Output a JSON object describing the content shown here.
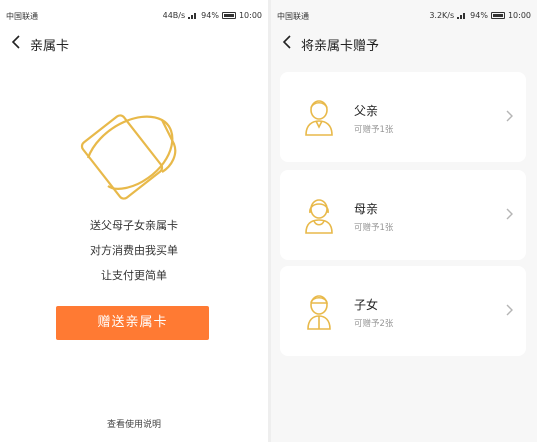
{
  "left": {
    "status": {
      "carrier": "中国联通",
      "speed": "44B/s",
      "battery": "94%",
      "time": "10:00"
    },
    "nav": {
      "title": "亲属卡"
    },
    "illustration": {
      "icon": "family-card-icon"
    },
    "copy": [
      "送父母子女亲属卡",
      "对方消费由我买单",
      "让支付更简单"
    ],
    "cta_label": "赠送亲属卡",
    "help_link": "查看使用说明",
    "accent": "#ff7a33",
    "illustration_color": "#e8b94a"
  },
  "right": {
    "status": {
      "carrier": "中国联通",
      "speed": "3.2K/s",
      "battery": "94%",
      "time": "10:00"
    },
    "nav": {
      "title": "将亲属卡赠予"
    },
    "options": [
      {
        "name": "父亲",
        "sub": "可赠予1张",
        "icon": "father-avatar-icon"
      },
      {
        "name": "母亲",
        "sub": "可赠予1张",
        "icon": "mother-avatar-icon"
      },
      {
        "name": "子女",
        "sub": "可赠予2张",
        "icon": "child-avatar-icon"
      }
    ]
  }
}
